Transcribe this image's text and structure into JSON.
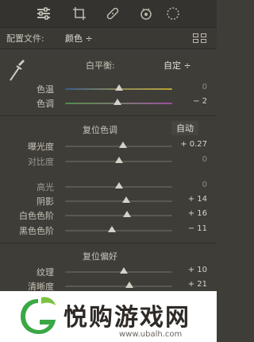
{
  "toolbar": {
    "tools": [
      {
        "icon": "sliders-icon",
        "glyph": "☰"
      },
      {
        "icon": "crop-icon",
        "glyph": "⌗"
      },
      {
        "icon": "healing-brush-icon",
        "glyph": "✎"
      },
      {
        "icon": "red-eye-icon",
        "glyph": "◉"
      },
      {
        "icon": "radial-filter-icon",
        "glyph": "◌"
      }
    ]
  },
  "profile": {
    "label": "配置文件:",
    "value": "颜色 ÷"
  },
  "white_balance": {
    "label": "白平衡:",
    "value": "自定 ÷",
    "sliders": [
      {
        "label": "色温",
        "value": "0",
        "position": 0.5
      },
      {
        "label": "色调",
        "value": "− 2",
        "position": 0.49
      }
    ]
  },
  "tone": {
    "title": "复位色调",
    "auto_label": "自动",
    "sliders": [
      {
        "label": "曝光度",
        "value": "+ 0.27",
        "position": 0.54
      },
      {
        "label": "对比度",
        "value": "0",
        "position": 0.5
      },
      {
        "label": "高光",
        "value": "0",
        "position": 0.5
      },
      {
        "label": "阴影",
        "value": "+ 14",
        "position": 0.57
      },
      {
        "label": "白色色阶",
        "value": "+ 16",
        "position": 0.58
      },
      {
        "label": "黑色色阶",
        "value": "− 11",
        "position": 0.44
      }
    ]
  },
  "presence": {
    "title": "复位偏好",
    "sliders": [
      {
        "label": "纹理",
        "value": "+ 10",
        "position": 0.55
      },
      {
        "label": "清晰度",
        "value": "+ 21",
        "position": 0.6
      }
    ]
  },
  "watermark": {
    "text": "悦购游戏网",
    "url": "www.ubalh.com"
  }
}
